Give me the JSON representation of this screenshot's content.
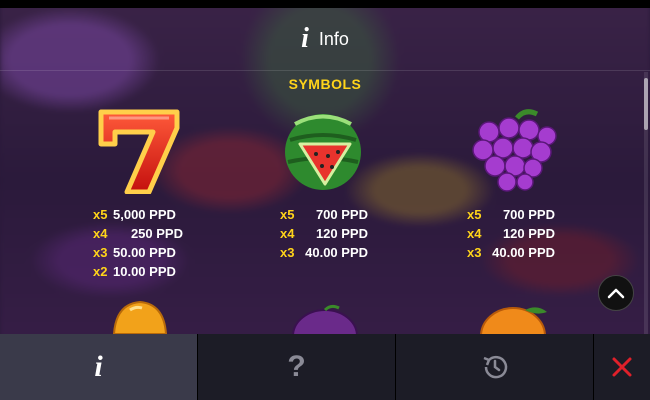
{
  "header": {
    "icon": "info-icon",
    "title": "Info"
  },
  "section": {
    "title": "SYMBOLS"
  },
  "symbols": [
    {
      "name": "seven",
      "icon": "seven-icon",
      "payouts": [
        {
          "mult": "x5",
          "amount": "5,000 PPD"
        },
        {
          "mult": "x4",
          "amount": "250 PPD"
        },
        {
          "mult": "x3",
          "amount": "50.00 PPD"
        },
        {
          "mult": "x2",
          "amount": "10.00 PPD"
        }
      ]
    },
    {
      "name": "watermelon",
      "icon": "watermelon-icon",
      "payouts": [
        {
          "mult": "x5",
          "amount": "700 PPD"
        },
        {
          "mult": "x4",
          "amount": "120 PPD"
        },
        {
          "mult": "x3",
          "amount": "40.00 PPD"
        }
      ]
    },
    {
      "name": "grapes",
      "icon": "grapes-icon",
      "payouts": [
        {
          "mult": "x5",
          "amount": "700 PPD"
        },
        {
          "mult": "x4",
          "amount": "120 PPD"
        },
        {
          "mult": "x3",
          "amount": "40.00 PPD"
        }
      ]
    }
  ],
  "partial_symbols": [
    "bell-icon",
    "plum-icon",
    "orange-icon"
  ],
  "scroll_button": {
    "icon": "chevron-up-icon"
  },
  "bottom_tabs": [
    {
      "name": "info",
      "icon": "info-icon",
      "glyph": "i",
      "active": true
    },
    {
      "name": "help",
      "icon": "question-icon",
      "glyph": "?",
      "active": false
    },
    {
      "name": "history",
      "icon": "history-icon",
      "active": false
    },
    {
      "name": "close",
      "icon": "close-icon",
      "active": false
    }
  ],
  "colors": {
    "accent": "#ffd41a",
    "close": "#e0202a",
    "text": "#ffffff"
  }
}
